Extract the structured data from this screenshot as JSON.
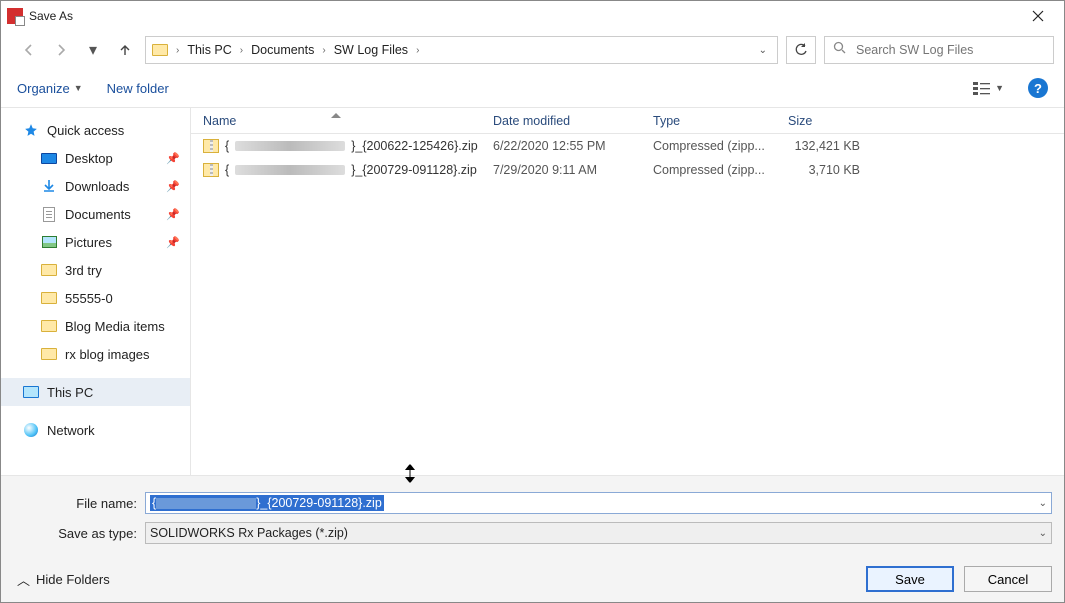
{
  "window": {
    "title": "Save As"
  },
  "breadcrumb": {
    "segments": [
      "This PC",
      "Documents",
      "SW Log Files"
    ]
  },
  "search": {
    "placeholder": "Search SW Log Files"
  },
  "toolbar": {
    "organize": "Organize",
    "newfolder": "New folder"
  },
  "sidebar": {
    "quick_access": "Quick access",
    "desktop": "Desktop",
    "downloads": "Downloads",
    "documents": "Documents",
    "pictures": "Pictures",
    "folders": [
      "3rd try",
      "55555-0",
      "Blog Media items",
      "rx blog images"
    ],
    "this_pc": "This PC",
    "network": "Network"
  },
  "columns": {
    "name": "Name",
    "date": "Date modified",
    "type": "Type",
    "size": "Size"
  },
  "files": [
    {
      "name_prefix": "{",
      "name_suffix": "}_{200622-125426}.zip",
      "date": "6/22/2020 12:55 PM",
      "type": "Compressed (zipp...",
      "size": "132,421 KB"
    },
    {
      "name_prefix": "{",
      "name_suffix": "}_{200729-091128}.zip",
      "date": "7/29/2020 9:11 AM",
      "type": "Compressed (zipp...",
      "size": "3,710 KB"
    }
  ],
  "form": {
    "filename_label": "File name:",
    "filename_prefix": "{",
    "filename_suffix": "}_{200729-091128}.zip",
    "saveas_label": "Save as type:",
    "saveas_value": "SOLIDWORKS Rx Packages (*.zip)"
  },
  "buttons": {
    "hide": "Hide Folders",
    "save": "Save",
    "cancel": "Cancel"
  }
}
